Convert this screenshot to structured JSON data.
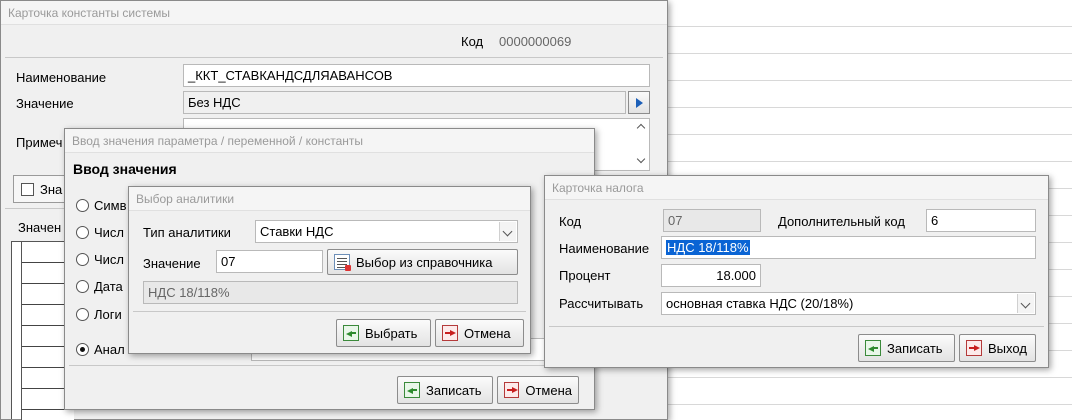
{
  "background": {
    "grid_color": "#d8d8d8"
  },
  "const_card": {
    "title": "Карточка константы системы",
    "code_label": "Код",
    "code_value": "0000000069",
    "name_label": "Наименование",
    "name_value": "_ККТ_СТАВКАНДСДЛЯАВАНСОВ",
    "value_label": "Значение",
    "value_value": "Без НДС",
    "value_button_icon": "arrow-right-icon",
    "note_label": "Примеч",
    "check_label": "Зна",
    "values_label": "Значен"
  },
  "param_dialog": {
    "title": "Ввод значения параметра / переменной / константы",
    "heading": "Ввод значения",
    "options": [
      {
        "label": "Симв",
        "selected": false
      },
      {
        "label": "Числ",
        "selected": false
      },
      {
        "label": "Числ",
        "selected": false
      },
      {
        "label": "Дата",
        "selected": false
      },
      {
        "label": "Логи",
        "selected": false
      },
      {
        "label": "Анал",
        "selected": true
      }
    ],
    "save_label": "Записать",
    "cancel_label": "Отмена"
  },
  "analytics_dialog": {
    "title": "Выбор аналитики",
    "type_label": "Тип аналитики",
    "type_value": "Ставки НДС",
    "value_label": "Значение",
    "value_value": "07",
    "pick_button": "Выбор из справочника",
    "description": "НДС 18/118%",
    "select_label": "Выбрать",
    "cancel_label": "Отмена"
  },
  "tax_card": {
    "title": "Карточка налога",
    "code_label": "Код",
    "code_value": "07",
    "extra_code_label": "Дополнительный код",
    "extra_code_value": "6",
    "name_label": "Наименование",
    "name_value": "НДС 18/118%",
    "percent_label": "Процент",
    "percent_value": "18.000",
    "calc_label": "Рассчитывать",
    "calc_value": "основная ставка НДС (20/18%)",
    "save_label": "Записать",
    "exit_label": "Выход"
  }
}
